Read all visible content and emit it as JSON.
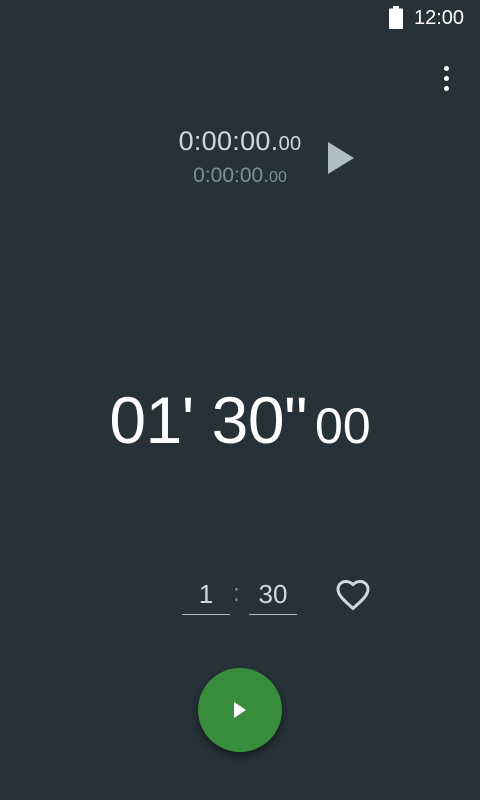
{
  "status_bar": {
    "time": "12:00",
    "battery_icon": "battery-full-icon"
  },
  "menu": {
    "icon": "more-vert-icon"
  },
  "lap": {
    "primary_main": "0:00:00.",
    "primary_frac": "00",
    "secondary_main": "0:00:00.",
    "secondary_frac": "00",
    "play_icon": "play-icon"
  },
  "timer": {
    "display_main": "01' 30\"",
    "display_frac": "00"
  },
  "inputs": {
    "minutes": "1",
    "separator": ":",
    "seconds": "30",
    "favorite_icon": "heart-outline-icon"
  },
  "fab": {
    "icon": "play-icon",
    "color": "#388e3c"
  },
  "colors": {
    "background": "#263238",
    "accent": "#388e3c"
  }
}
